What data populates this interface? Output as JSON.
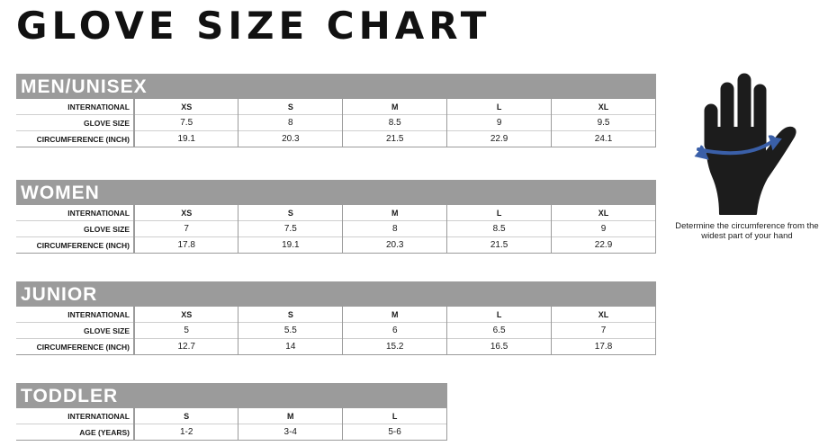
{
  "title": "GLOVE SIZE CHART",
  "sections": [
    {
      "heading": "MEN/UNISEX",
      "rows": [
        {
          "label": "INTERNATIONAL",
          "values": [
            "XS",
            "S",
            "M",
            "L",
            "XL"
          ]
        },
        {
          "label": "GLOVE SIZE",
          "values": [
            "7.5",
            "8",
            "8.5",
            "9",
            "9.5"
          ]
        },
        {
          "label": "CIRCUMFERENCE (INCH)",
          "values": [
            "19.1",
            "20.3",
            "21.5",
            "22.9",
            "24.1"
          ]
        }
      ]
    },
    {
      "heading": "WOMEN",
      "rows": [
        {
          "label": "INTERNATIONAL",
          "values": [
            "XS",
            "S",
            "M",
            "L",
            "XL"
          ]
        },
        {
          "label": "GLOVE SIZE",
          "values": [
            "7",
            "7.5",
            "8",
            "8.5",
            "9"
          ]
        },
        {
          "label": "CIRCUMFERENCE (INCH)",
          "values": [
            "17.8",
            "19.1",
            "20.3",
            "21.5",
            "22.9"
          ]
        }
      ]
    },
    {
      "heading": "JUNIOR",
      "rows": [
        {
          "label": "INTERNATIONAL",
          "values": [
            "XS",
            "S",
            "M",
            "L",
            "XL"
          ]
        },
        {
          "label": "GLOVE SIZE",
          "values": [
            "5",
            "5.5",
            "6",
            "6.5",
            "7"
          ]
        },
        {
          "label": "CIRCUMFERENCE (INCH)",
          "values": [
            "12.7",
            "14",
            "15.2",
            "16.5",
            "17.8"
          ]
        }
      ]
    },
    {
      "heading": "TODDLER",
      "rows": [
        {
          "label": "INTERNATIONAL",
          "values": [
            "S",
            "M",
            "L"
          ]
        },
        {
          "label": "AGE (YEARS)",
          "values": [
            "1-2",
            "3-4",
            "5-6"
          ]
        }
      ]
    }
  ],
  "figure": {
    "icon": "hand-measure-icon",
    "caption": "Determine the circumference from the widest part of your hand",
    "colors": {
      "hand": "#1c1c1c",
      "tape": "#3a5fa8"
    }
  },
  "colors": {
    "section_header": "#9b9b9b",
    "grid_line": "#9b9b9b"
  }
}
